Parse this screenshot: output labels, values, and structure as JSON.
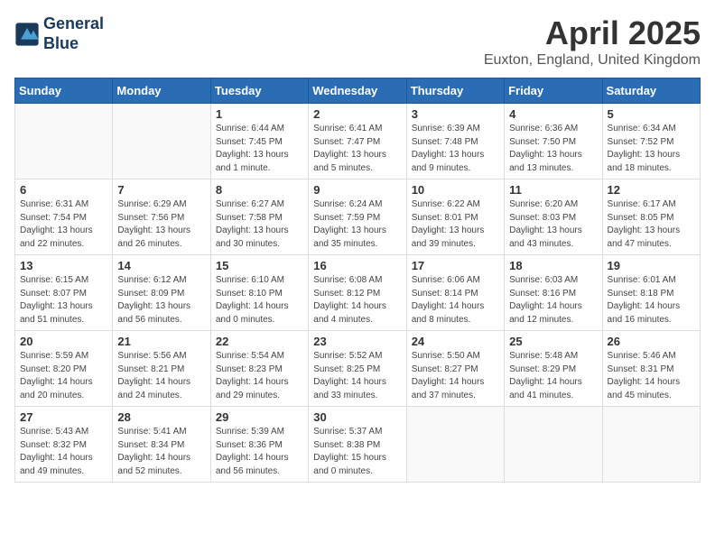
{
  "header": {
    "logo_line1": "General",
    "logo_line2": "Blue",
    "month_title": "April 2025",
    "location": "Euxton, England, United Kingdom"
  },
  "weekdays": [
    "Sunday",
    "Monday",
    "Tuesday",
    "Wednesday",
    "Thursday",
    "Friday",
    "Saturday"
  ],
  "weeks": [
    [
      {
        "day": "",
        "info": ""
      },
      {
        "day": "",
        "info": ""
      },
      {
        "day": "1",
        "info": "Sunrise: 6:44 AM\nSunset: 7:45 PM\nDaylight: 13 hours and 1 minute."
      },
      {
        "day": "2",
        "info": "Sunrise: 6:41 AM\nSunset: 7:47 PM\nDaylight: 13 hours and 5 minutes."
      },
      {
        "day": "3",
        "info": "Sunrise: 6:39 AM\nSunset: 7:48 PM\nDaylight: 13 hours and 9 minutes."
      },
      {
        "day": "4",
        "info": "Sunrise: 6:36 AM\nSunset: 7:50 PM\nDaylight: 13 hours and 13 minutes."
      },
      {
        "day": "5",
        "info": "Sunrise: 6:34 AM\nSunset: 7:52 PM\nDaylight: 13 hours and 18 minutes."
      }
    ],
    [
      {
        "day": "6",
        "info": "Sunrise: 6:31 AM\nSunset: 7:54 PM\nDaylight: 13 hours and 22 minutes."
      },
      {
        "day": "7",
        "info": "Sunrise: 6:29 AM\nSunset: 7:56 PM\nDaylight: 13 hours and 26 minutes."
      },
      {
        "day": "8",
        "info": "Sunrise: 6:27 AM\nSunset: 7:58 PM\nDaylight: 13 hours and 30 minutes."
      },
      {
        "day": "9",
        "info": "Sunrise: 6:24 AM\nSunset: 7:59 PM\nDaylight: 13 hours and 35 minutes."
      },
      {
        "day": "10",
        "info": "Sunrise: 6:22 AM\nSunset: 8:01 PM\nDaylight: 13 hours and 39 minutes."
      },
      {
        "day": "11",
        "info": "Sunrise: 6:20 AM\nSunset: 8:03 PM\nDaylight: 13 hours and 43 minutes."
      },
      {
        "day": "12",
        "info": "Sunrise: 6:17 AM\nSunset: 8:05 PM\nDaylight: 13 hours and 47 minutes."
      }
    ],
    [
      {
        "day": "13",
        "info": "Sunrise: 6:15 AM\nSunset: 8:07 PM\nDaylight: 13 hours and 51 minutes."
      },
      {
        "day": "14",
        "info": "Sunrise: 6:12 AM\nSunset: 8:09 PM\nDaylight: 13 hours and 56 minutes."
      },
      {
        "day": "15",
        "info": "Sunrise: 6:10 AM\nSunset: 8:10 PM\nDaylight: 14 hours and 0 minutes."
      },
      {
        "day": "16",
        "info": "Sunrise: 6:08 AM\nSunset: 8:12 PM\nDaylight: 14 hours and 4 minutes."
      },
      {
        "day": "17",
        "info": "Sunrise: 6:06 AM\nSunset: 8:14 PM\nDaylight: 14 hours and 8 minutes."
      },
      {
        "day": "18",
        "info": "Sunrise: 6:03 AM\nSunset: 8:16 PM\nDaylight: 14 hours and 12 minutes."
      },
      {
        "day": "19",
        "info": "Sunrise: 6:01 AM\nSunset: 8:18 PM\nDaylight: 14 hours and 16 minutes."
      }
    ],
    [
      {
        "day": "20",
        "info": "Sunrise: 5:59 AM\nSunset: 8:20 PM\nDaylight: 14 hours and 20 minutes."
      },
      {
        "day": "21",
        "info": "Sunrise: 5:56 AM\nSunset: 8:21 PM\nDaylight: 14 hours and 24 minutes."
      },
      {
        "day": "22",
        "info": "Sunrise: 5:54 AM\nSunset: 8:23 PM\nDaylight: 14 hours and 29 minutes."
      },
      {
        "day": "23",
        "info": "Sunrise: 5:52 AM\nSunset: 8:25 PM\nDaylight: 14 hours and 33 minutes."
      },
      {
        "day": "24",
        "info": "Sunrise: 5:50 AM\nSunset: 8:27 PM\nDaylight: 14 hours and 37 minutes."
      },
      {
        "day": "25",
        "info": "Sunrise: 5:48 AM\nSunset: 8:29 PM\nDaylight: 14 hours and 41 minutes."
      },
      {
        "day": "26",
        "info": "Sunrise: 5:46 AM\nSunset: 8:31 PM\nDaylight: 14 hours and 45 minutes."
      }
    ],
    [
      {
        "day": "27",
        "info": "Sunrise: 5:43 AM\nSunset: 8:32 PM\nDaylight: 14 hours and 49 minutes."
      },
      {
        "day": "28",
        "info": "Sunrise: 5:41 AM\nSunset: 8:34 PM\nDaylight: 14 hours and 52 minutes."
      },
      {
        "day": "29",
        "info": "Sunrise: 5:39 AM\nSunset: 8:36 PM\nDaylight: 14 hours and 56 minutes."
      },
      {
        "day": "30",
        "info": "Sunrise: 5:37 AM\nSunset: 8:38 PM\nDaylight: 15 hours and 0 minutes."
      },
      {
        "day": "",
        "info": ""
      },
      {
        "day": "",
        "info": ""
      },
      {
        "day": "",
        "info": ""
      }
    ]
  ]
}
